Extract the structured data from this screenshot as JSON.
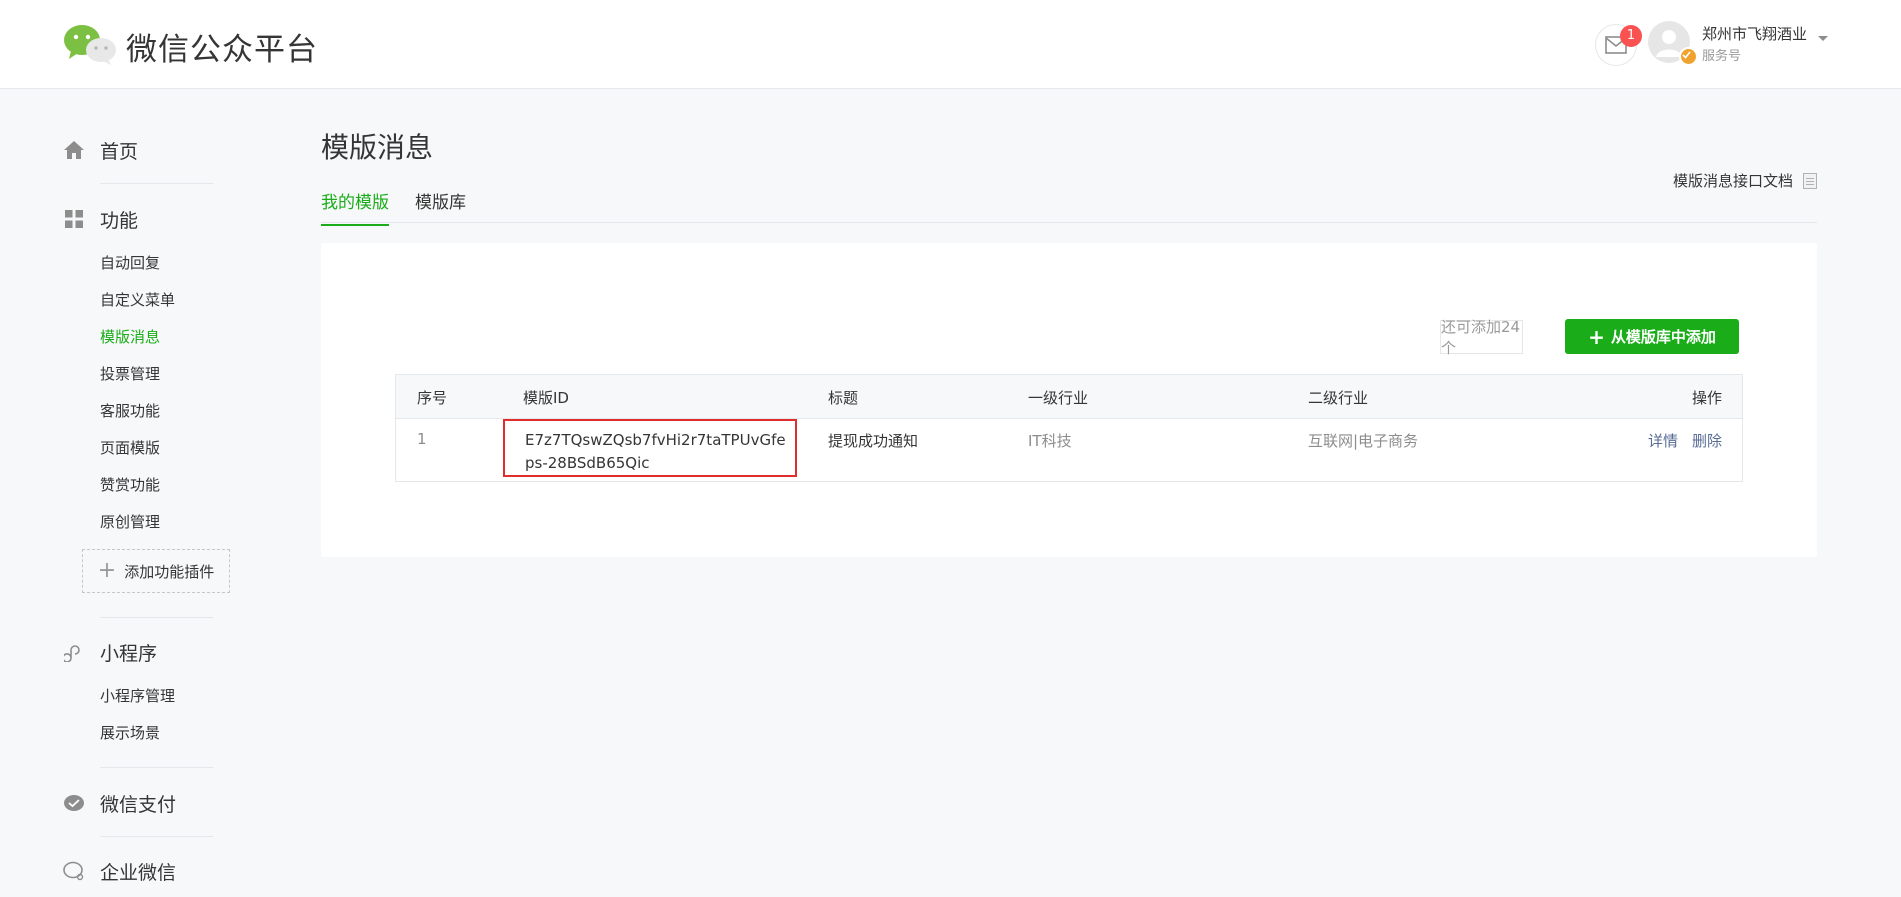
{
  "header": {
    "brand": "微信公众平台",
    "notification_count": "1",
    "account_name": "郑州市飞翔酒业",
    "account_type": "服务号"
  },
  "sidebar": {
    "home": "首页",
    "features": "功能",
    "feature_items": [
      "自动回复",
      "自定义菜单",
      "模版消息",
      "投票管理",
      "客服功能",
      "页面模版",
      "赞赏功能",
      "原创管理"
    ],
    "add_plugin": "添加功能插件",
    "miniprogram": "小程序",
    "miniprogram_items": [
      "小程序管理",
      "展示场景"
    ],
    "wechat_pay": "微信支付",
    "enterprise_wechat": "企业微信"
  },
  "main": {
    "title": "模版消息",
    "tabs": [
      "我的模版",
      "模版库"
    ],
    "doc_link": "模版消息接口文档",
    "quota_text": "还可添加24个",
    "add_button": "从模版库中添加",
    "table": {
      "headers": [
        "序号",
        "模版ID",
        "标题",
        "一级行业",
        "二级行业",
        "操作"
      ],
      "rows": [
        {
          "index": "1",
          "template_id": "E7z7TQswZQsb7fvHi2r7taTPUvGfeps-28BSdB65Qic",
          "title": "提现成功通知",
          "industry_primary": "IT科技",
          "industry_secondary": "互联网|电子商务",
          "actions": [
            "详情",
            "删除"
          ]
        }
      ]
    }
  },
  "colors": {
    "accent_green": "#1aad19",
    "link_blue": "#576b95",
    "highlight_red": "#e02e2e",
    "badge_red": "#fa5151"
  }
}
